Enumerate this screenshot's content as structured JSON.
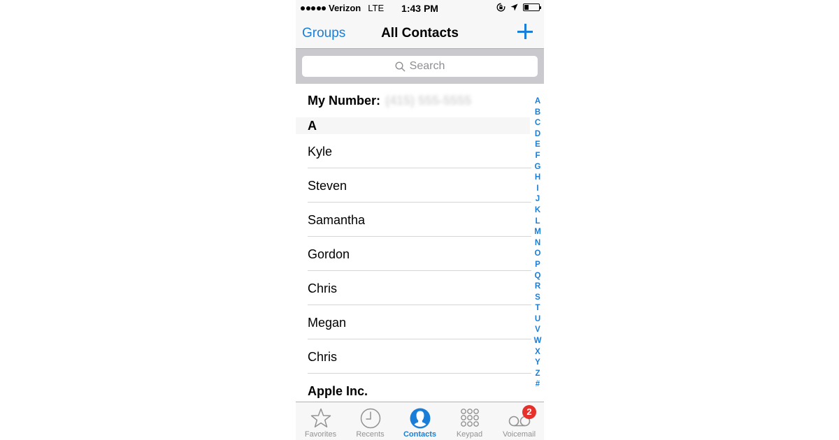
{
  "status_bar": {
    "signal_bars": 5,
    "carrier": "Verizon",
    "network": "LTE",
    "time": "1:43 PM",
    "icons": [
      "orientation-lock-icon",
      "location-arrow-icon",
      "battery-icon"
    ],
    "battery_level": 0.3
  },
  "nav": {
    "left_button": "Groups",
    "title": "All Contacts",
    "right_button_icon": "plus-icon"
  },
  "search": {
    "placeholder": "Search",
    "icon": "search-icon"
  },
  "my_number": {
    "label": "My Number:",
    "value": "(415) 555-5555"
  },
  "section": {
    "letter": "A"
  },
  "contacts": [
    {
      "name": "Kyle"
    },
    {
      "name": "Steven"
    },
    {
      "name": "Samantha"
    },
    {
      "name": "Gordon"
    },
    {
      "name": "Chris"
    },
    {
      "name": "Megan"
    },
    {
      "name": "Chris"
    },
    {
      "name": "Apple Inc."
    }
  ],
  "index_letters": [
    "A",
    "B",
    "C",
    "D",
    "E",
    "F",
    "G",
    "H",
    "I",
    "J",
    "K",
    "L",
    "M",
    "N",
    "O",
    "P",
    "Q",
    "R",
    "S",
    "T",
    "U",
    "V",
    "W",
    "X",
    "Y",
    "Z",
    "#"
  ],
  "tabs": [
    {
      "label": "Favorites",
      "icon": "star-icon",
      "active": false
    },
    {
      "label": "Recents",
      "icon": "clock-icon",
      "active": false
    },
    {
      "label": "Contacts",
      "icon": "person-icon",
      "active": true
    },
    {
      "label": "Keypad",
      "icon": "keypad-icon",
      "active": false
    },
    {
      "label": "Voicemail",
      "icon": "voicemail-icon",
      "active": false,
      "badge": "2"
    }
  ],
  "colors": {
    "accent": "#1a7ed8",
    "badge": "#e5302b",
    "bar_background": "#f7f7f7",
    "search_background": "#c9c9ce"
  }
}
